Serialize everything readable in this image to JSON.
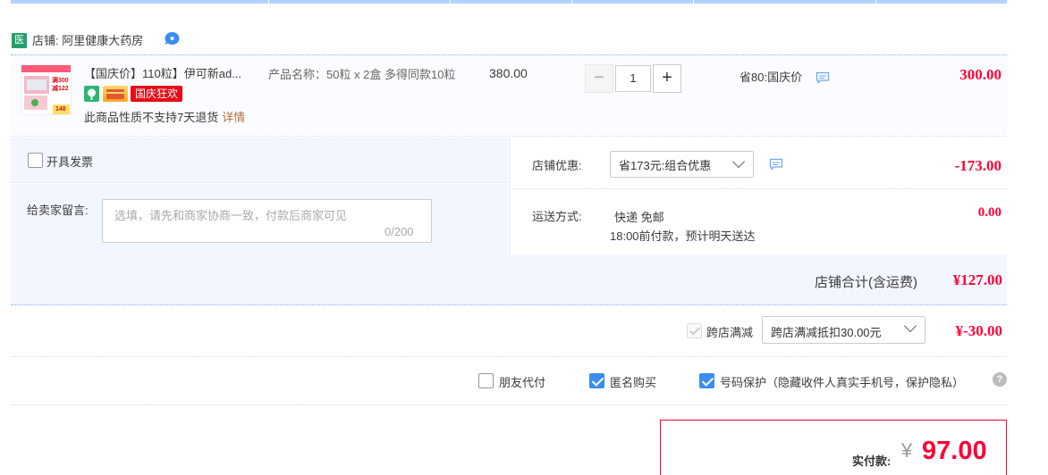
{
  "shop": {
    "badge": "医",
    "label": "店铺: 阿里健康大药房"
  },
  "item": {
    "thumb_lines": [
      "满300",
      "减122",
      "148"
    ],
    "title": "【国庆价】110粒】伊可新ad...",
    "tag_sale": "国庆狂欢",
    "no_return": "此商品性质不支持7天退货",
    "details_link": "详情",
    "spec": "产品名称：50粒 x 2盒 多得同款10粒",
    "unit_price": "380.00",
    "quantity": "1",
    "minus": "−",
    "plus": "+",
    "promo": "省80:国庆价",
    "total": "300.00"
  },
  "invoice": {
    "label": "开具发票"
  },
  "message": {
    "label": "给卖家留言:",
    "placeholder": "选填，请先和商家协商一致，付款后商家可见",
    "count": "0/200"
  },
  "discount": {
    "label": "店铺优惠:",
    "selected": "省173元:组合优惠",
    "amount": "-173.00"
  },
  "shipping": {
    "label": "运送方式:",
    "method": "快递 免邮",
    "eta": "18:00前付款，预计明天送达",
    "amount": "0.00"
  },
  "subtotal": {
    "label": "店铺合计(含运费)",
    "amount": "¥127.00"
  },
  "cross_store": {
    "label": "跨店满减",
    "selected": "跨店满减抵扣30.00元",
    "amount": "¥-30.00"
  },
  "options": {
    "friend_pay": "朋友代付",
    "anonymous": "匿名购买",
    "phone_protect": "号码保护（隐藏收件人真实手机号，保护隐私）",
    "help": "?"
  },
  "payment": {
    "label": "实付款:",
    "currency": "¥",
    "amount": "97.00"
  },
  "colors": {
    "accent_red": "#ff0036",
    "checkbox_blue": "#3b8ef0",
    "panel_blue": "#f2f7ff"
  }
}
